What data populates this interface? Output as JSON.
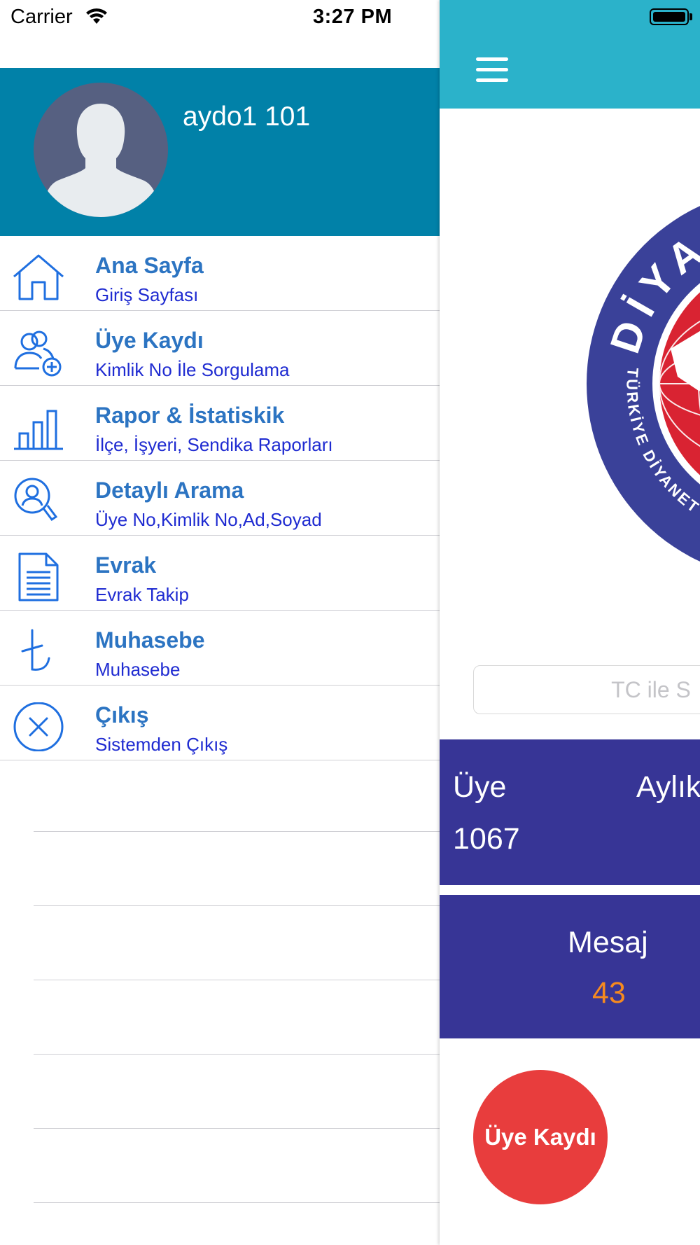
{
  "status_bar": {
    "carrier": "Carrier",
    "time": "3:27 PM"
  },
  "drawer": {
    "username": "aydo1 101",
    "menu": [
      {
        "title": "Ana Sayfa",
        "subtitle": "Giriş Sayfası",
        "icon": "home-icon"
      },
      {
        "title": "Üye Kaydı",
        "subtitle": "Kimlik No İle Sorgulama",
        "icon": "add-user-icon"
      },
      {
        "title": "Rapor & İstatiskik",
        "subtitle": "İlçe, İşyeri, Sendika Raporları",
        "icon": "bar-chart-icon"
      },
      {
        "title": "Detaylı Arama",
        "subtitle": "Üye No,Kimlik No,Ad,Soyad",
        "icon": "user-search-icon"
      },
      {
        "title": "Evrak",
        "subtitle": "Evrak Takip",
        "icon": "document-icon"
      },
      {
        "title": "Muhasebe",
        "subtitle": "Muhasebe",
        "icon": "lira-icon"
      },
      {
        "title": "Çıkış",
        "subtitle": "Sistemden Çıkış",
        "icon": "close-circle-icon"
      }
    ]
  },
  "main": {
    "search_placeholder": "TC ile S",
    "stat1": {
      "label_members": "Üye",
      "value_members": "1067",
      "label_monthly": "Aylık"
    },
    "stat2": {
      "label": "Mesaj",
      "value": "43"
    },
    "fab_label": "Üye Kaydı",
    "logo_text_top": "DİYA",
    "logo_text_side": "TÜRKİYE DİYANET"
  },
  "colors": {
    "drawer_header": "#0181a8",
    "appbar": "#2bb2ca",
    "stat_panel": "#373596",
    "accent_orange": "#f68a1f",
    "fab": "#e83d3d",
    "menu_title": "#2c74c2",
    "menu_subtitle": "#1f2bd1"
  }
}
